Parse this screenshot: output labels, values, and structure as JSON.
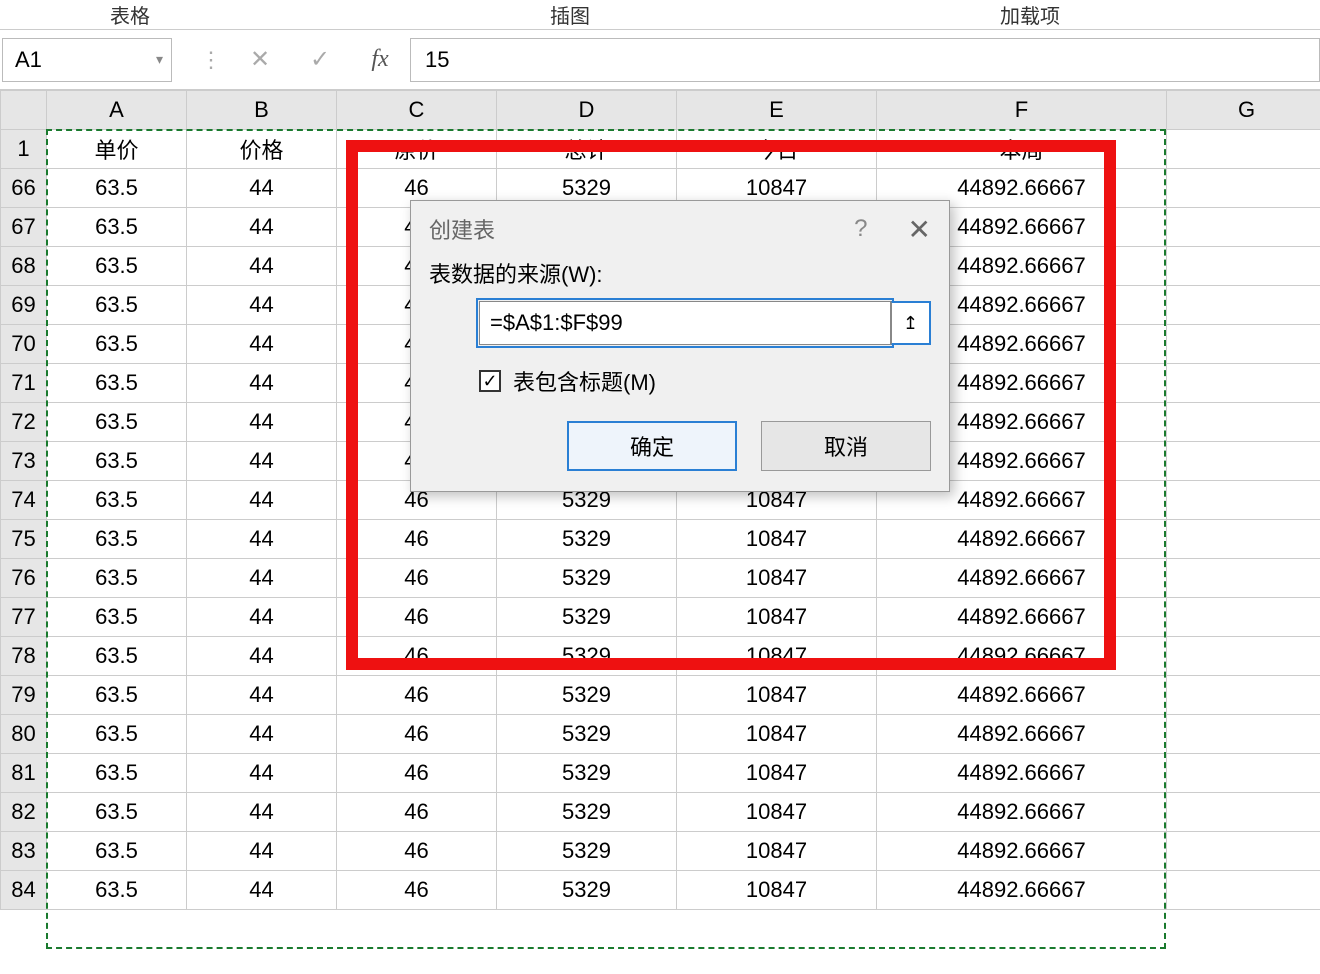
{
  "ribbon": {
    "tab_tables": "表格",
    "tab_illustrations": "插图",
    "tab_addins": "加载项"
  },
  "formula_bar": {
    "name_box": "A1",
    "cancel_glyph": "✕",
    "enter_glyph": "✓",
    "fx_glyph": "fx",
    "formula_value": "15"
  },
  "columns": [
    "A",
    "B",
    "C",
    "D",
    "E",
    "F",
    "G"
  ],
  "header_row_num": "1",
  "headers": {
    "A": "单价",
    "B": "价格",
    "C": "原价",
    "D": "总计",
    "E": "今日",
    "F": "本周",
    "G": ""
  },
  "row_numbers": [
    "66",
    "67",
    "68",
    "69",
    "70",
    "71",
    "72",
    "73",
    "74",
    "75",
    "76",
    "77",
    "78",
    "79",
    "80",
    "81",
    "82",
    "83",
    "84"
  ],
  "row_template": {
    "A": "63.5",
    "B": "44",
    "C": "46",
    "D": "5329",
    "E": "10847",
    "F": "44892.66667",
    "G": ""
  },
  "dialog": {
    "title": "创建表",
    "help_glyph": "?",
    "close_glyph": "✕",
    "source_label": "表数据的来源(W):",
    "range_value": "=$A$1:$F$99",
    "collapse_glyph": "↥",
    "checkbox_checked": true,
    "checkbox_label": "表包含标题(M)",
    "ok_label": "确定",
    "cancel_label": "取消"
  }
}
